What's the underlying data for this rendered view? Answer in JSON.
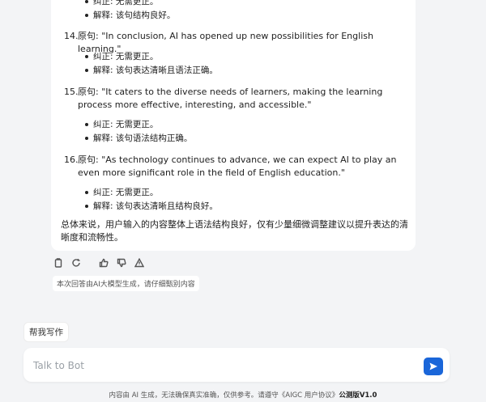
{
  "message": {
    "top_bullets": [
      "纠正: 无需更正。",
      "解释: 该句结构良好。"
    ],
    "items": [
      {
        "num": "14.",
        "original": "原句: \"In conclusion, AI has opened up new possibilities for English learning.\"",
        "correction": "纠正: 无需更正。",
        "explanation": "解释: 该句表达清晰且语法正确。"
      },
      {
        "num": "15.",
        "original": "原句: \"It caters to the diverse needs of learners, making the learning process more effective, interesting, and accessible.\"",
        "correction": "纠正: 无需更正。",
        "explanation": "解释: 该句语法结构正确。"
      },
      {
        "num": "16.",
        "original": "原句: \"As technology continues to advance, we can expect AI to play an even more significant role in the field of English education.\"",
        "correction": "纠正: 无需更正。",
        "explanation": "解释: 该句表达清晰且结构良好。"
      }
    ],
    "summary": "总体来说，用户输入的内容整体上语法结构良好，仅有少量细微调整建议以提升表达的清晰度和流畅性。"
  },
  "actions": {
    "icons": [
      "copy-icon",
      "regenerate-icon",
      "thumbs-up-icon",
      "thumbs-down-icon",
      "warning-icon"
    ]
  },
  "disclaimer": "本次回答由AI大模型生成，请仔细甄别内容",
  "helper_chip": "帮我写作",
  "input": {
    "placeholder": "Talk to Bot",
    "value": ""
  },
  "footer": {
    "text": "内容由 AI 生成，无法确保真实准确，仅供参考。请遵守《AIGC 用户协议》",
    "version": "公测版V1.0"
  },
  "colors": {
    "accent": "#1a66d9",
    "background": "#f3f4f6",
    "card": "#ffffff"
  }
}
